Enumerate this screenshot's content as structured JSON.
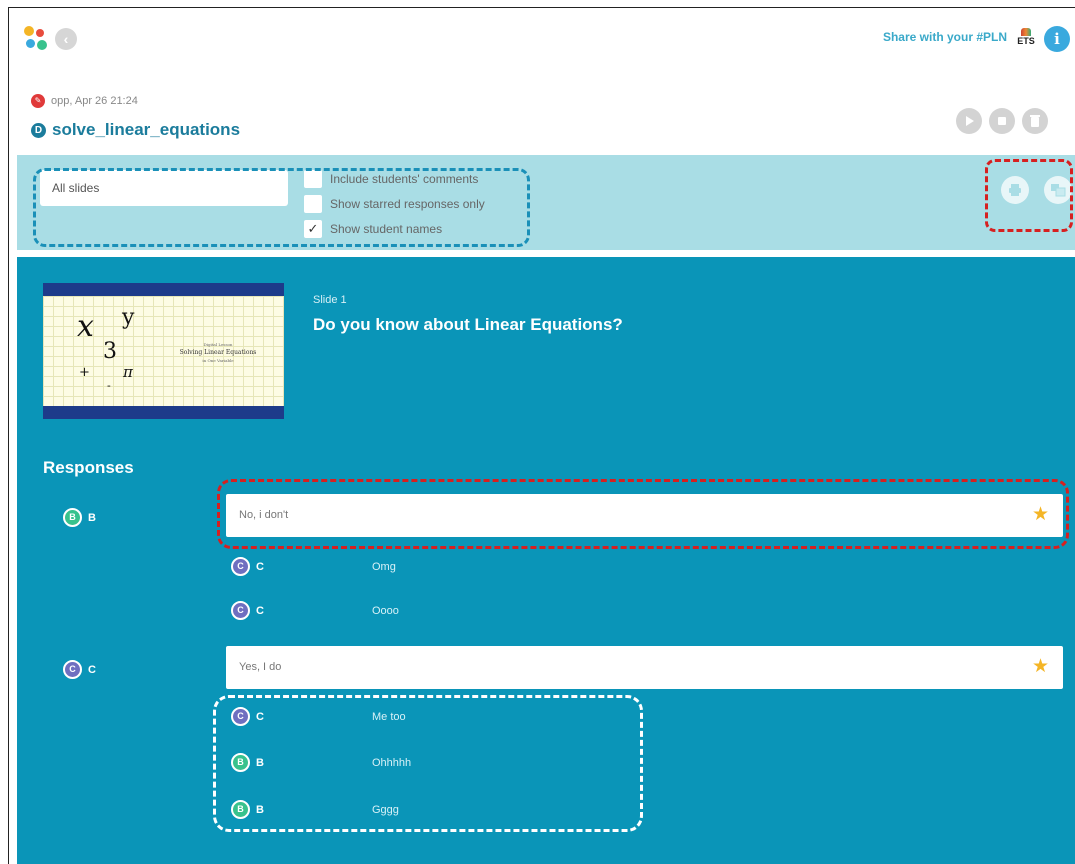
{
  "app": {
    "back_label": "‹",
    "share_label": "Share with your #PLN",
    "ets_label": "ETS",
    "info_label": "i"
  },
  "session": {
    "meta": "opp, Apr 26 21:24",
    "title": "solve_linear_equations",
    "type_icon_label": "D"
  },
  "filters": {
    "slides_select": "All slides",
    "options": [
      {
        "label": "Include students' comments",
        "checked": false
      },
      {
        "label": "Show starred responses only",
        "checked": false
      },
      {
        "label": "Show student names",
        "checked": true
      }
    ]
  },
  "slide": {
    "number": "Slide 1",
    "question": "Do you know about Linear Equations?",
    "thumbnail": {
      "title": "Solving Linear Equations",
      "subtitle": "in One Variable",
      "header": "Digital Lesson",
      "symbols": [
        "x",
        "y",
        "3",
        "+",
        "π",
        "-"
      ]
    }
  },
  "responses": {
    "heading": "Responses",
    "items": [
      {
        "student": "B",
        "text": "No, i don't",
        "starred": true,
        "comments": [
          {
            "student": "C",
            "text": "Omg"
          },
          {
            "student": "C",
            "text": "Oooo"
          }
        ]
      },
      {
        "student": "C",
        "text": "Yes, I do",
        "starred": true,
        "comments": [
          {
            "student": "C",
            "text": "Me too"
          },
          {
            "student": "B",
            "text": "Ohhhhh"
          },
          {
            "student": "B",
            "text": "Gggg"
          }
        ]
      }
    ]
  },
  "colors": {
    "accent": "#0a95b8",
    "filter_bar": "#a9dde5",
    "title": "#1b7c9c",
    "star": "#f4b526",
    "student_b": "#38c28d",
    "student_c": "#6f6fc0"
  }
}
